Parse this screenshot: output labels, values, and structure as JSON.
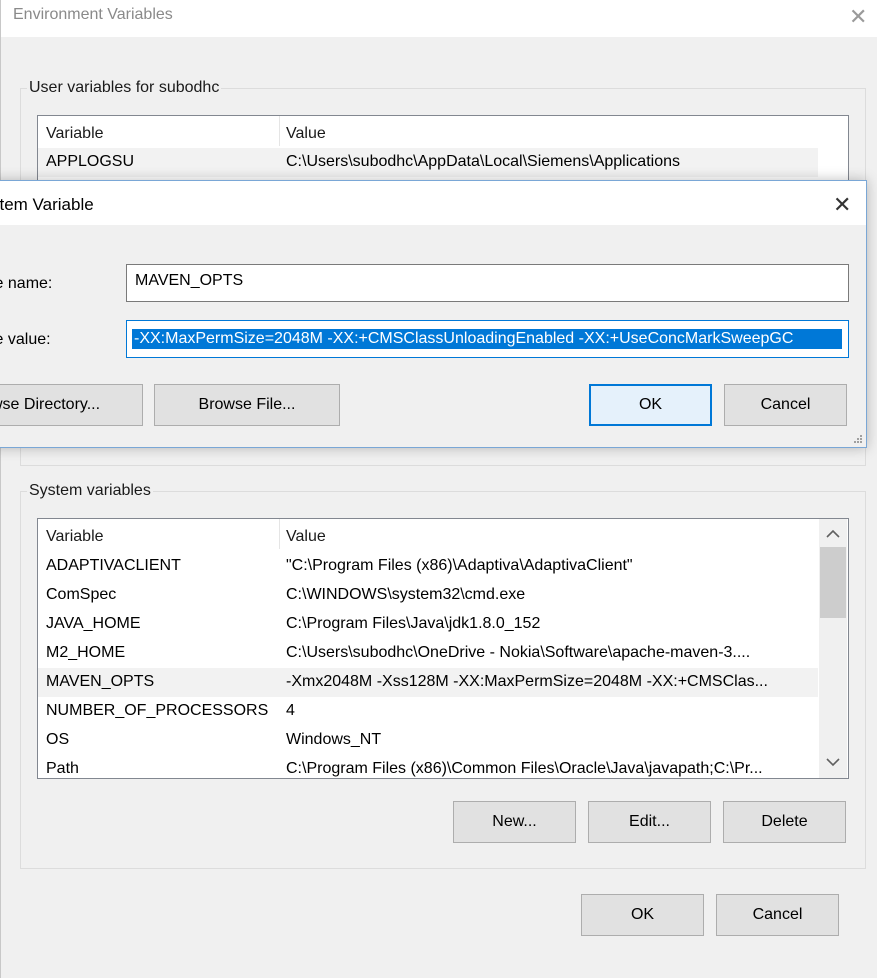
{
  "window": {
    "title": "Environment Variables",
    "close_glyph": "✕"
  },
  "user_vars": {
    "group_label": "User variables for subodhc",
    "col_variable": "Variable",
    "col_value": "Value",
    "rows": [
      {
        "name": "APPLOGSU",
        "value": "C:\\Users\\subodhc\\AppData\\Local\\Siemens\\Applications"
      }
    ]
  },
  "edit_dialog": {
    "title": "stem Variable",
    "close_glyph": "✕",
    "name_label": "le name:",
    "value_label": "le value:",
    "name_value": "MAVEN_OPTS",
    "value_value": "-XX:MaxPermSize=2048M -XX:+CMSClassUnloadingEnabled -XX:+UseConcMarkSweepGC",
    "browse_directory_label": "wse Directory...",
    "browse_file_label": "Browse File...",
    "ok_label": "OK",
    "cancel_label": "Cancel"
  },
  "system_vars": {
    "group_label": "System variables",
    "col_variable": "Variable",
    "col_value": "Value",
    "selected_index": 4,
    "rows": [
      {
        "name": "ADAPTIVACLIENT",
        "value": "\"C:\\Program Files (x86)\\Adaptiva\\AdaptivaClient\""
      },
      {
        "name": "ComSpec",
        "value": "C:\\WINDOWS\\system32\\cmd.exe"
      },
      {
        "name": "JAVA_HOME",
        "value": "C:\\Program Files\\Java\\jdk1.8.0_152"
      },
      {
        "name": "M2_HOME",
        "value": "C:\\Users\\subodhc\\OneDrive - Nokia\\Software\\apache-maven-3...."
      },
      {
        "name": "MAVEN_OPTS",
        "value": "-Xmx2048M -Xss128M -XX:MaxPermSize=2048M -XX:+CMSClas..."
      },
      {
        "name": "NUMBER_OF_PROCESSORS",
        "value": "4"
      },
      {
        "name": "OS",
        "value": "Windows_NT"
      },
      {
        "name": "Path",
        "value": "C:\\Program Files (x86)\\Common Files\\Oracle\\Java\\javapath;C:\\Pr..."
      }
    ],
    "new_label": "New...",
    "edit_label": "Edit...",
    "delete_label": "Delete",
    "scroll_up_icon": "chevron-up-icon",
    "scroll_down_icon": "chevron-down-icon"
  },
  "footer": {
    "ok_label": "OK",
    "cancel_label": "Cancel"
  },
  "colors": {
    "selection": "#0078d7",
    "row_highlight": "#f2f2f2",
    "button_face": "#e1e1e1"
  }
}
